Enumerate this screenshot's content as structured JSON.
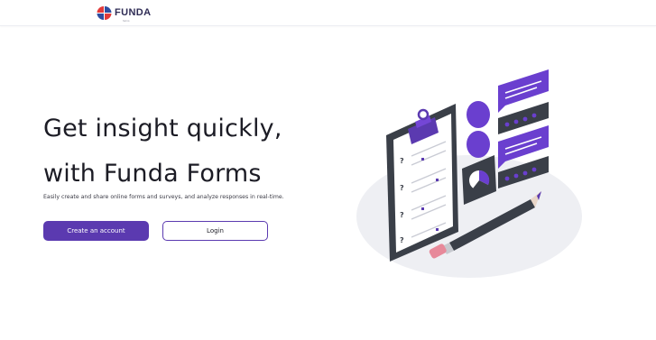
{
  "header": {
    "logo_text": "FUNDA",
    "logo_tagline": "forms"
  },
  "hero": {
    "title_line1": "Get insight quickly,",
    "title_line2": "with Funda Forms",
    "subtitle": "Easily create and share online forms and surveys, and analyze responses in real-time.",
    "primary_button": "Create an account",
    "secondary_button": "Login"
  },
  "colors": {
    "accent": "#5b3ab0",
    "dark": "#3a3f48",
    "pencil_tip": "#e7899a"
  },
  "icons": {
    "logo": "funda-logo-icon",
    "illustration": "clipboard-survey-illustration"
  }
}
